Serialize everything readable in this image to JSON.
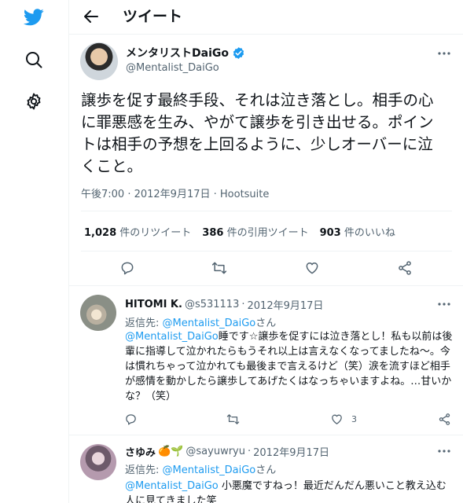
{
  "header": {
    "title": "ツイート"
  },
  "tweet": {
    "author_name": "メンタリストDaiGo",
    "author_handle": "@Mentalist_DaiGo",
    "text": "譲歩を促す最終手段、それは泣き落とし。相手の心に罪悪感を生み、やがて譲歩を引き出せる。ポイントは相手の予想を上回るように、少しオーバーに泣くこと。",
    "meta": "午後7:00 · 2012年9月17日 · Hootsuite",
    "retweets_count": "1,028",
    "retweets_label": "件のリツイート",
    "quotes_count": "386",
    "quotes_label": "件の引用ツイート",
    "likes_count": "903",
    "likes_label": "件のいいね"
  },
  "replies": [
    {
      "name": "HITOMI K.",
      "handle": "@s531113",
      "dot": "·",
      "date": "2012年9月17日",
      "reply_to_prefix": "返信先: ",
      "reply_to_handle": "@Mentalist_DaiGo",
      "reply_to_suffix": "さん",
      "body_mention": "@Mentalist_DaiGo",
      "body_text": "睡です☆譲歩を促すには泣き落とし！私も以前は後輩に指導して泣かれたらもうそれ以上は言えなくなってましたね〜。今は慣れちゃって泣かれても最後まで言えるけど（笑）涙を流すほど相手が感情を動かしたら譲歩してあげたくはなっちゃいますよね。…甘いかな？（笑）",
      "like_count": "3"
    },
    {
      "name": "さゆみ",
      "name_emoji": "🍊🌱",
      "handle": "@sayuwryu",
      "dot": "·",
      "date": "2012年9月17日",
      "reply_to_prefix": "返信先: ",
      "reply_to_handle": "@Mentalist_DaiGo",
      "reply_to_suffix": "さん",
      "body_mention": "@Mentalist_DaiGo",
      "body_text": " 小悪魔ですねっ！最近だんだん悪いこと教え込む人に見てきました笑"
    }
  ],
  "colors": {
    "brand": "#1d9bf0",
    "text": "#0f1419",
    "muted": "#536471",
    "border": "#eff3f4"
  },
  "icons": [
    "twitter-logo-icon",
    "search-icon",
    "gear-icon",
    "back-arrow-icon",
    "verified-badge-icon",
    "more-icon",
    "reply-icon",
    "retweet-icon",
    "like-icon",
    "share-icon"
  ]
}
